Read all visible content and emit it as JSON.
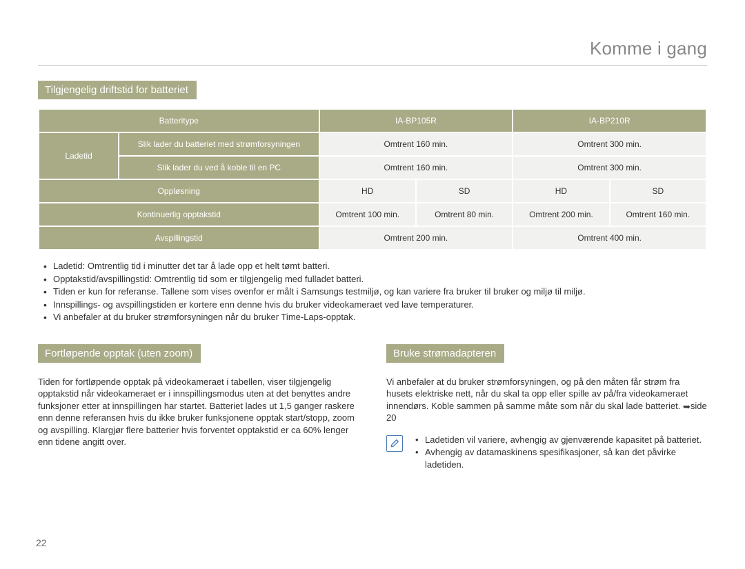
{
  "page_number": "22",
  "header_title": "Komme i gang",
  "section1": {
    "title": "Tilgjengelig driftstid for batteriet",
    "table": {
      "batteritype_label": "Batteritype",
      "col1": "IA-BP105R",
      "col2": "IA-BP210R",
      "ladetid_label": "Ladetid",
      "charge_ps_label": "Slik lader du batteriet med strømforsyningen",
      "charge_ps_c1": "Omtrent 160 min.",
      "charge_ps_c2": "Omtrent 300 min.",
      "charge_pc_label": "Slik lader du ved å koble til en PC",
      "charge_pc_c1": "Omtrent 160 min.",
      "charge_pc_c2": "Omtrent 300 min.",
      "res_label": "Oppløsning",
      "hd": "HD",
      "sd": "SD",
      "cont_label": "Kontinuerlig opptakstid",
      "cont_a": "Omtrent 100 min.",
      "cont_b": "Omtrent 80 min.",
      "cont_c": "Omtrent 200 min.",
      "cont_d": "Omtrent 160 min.",
      "play_label": "Avspillingstid",
      "play_c1": "Omtrent 200 min.",
      "play_c2": "Omtrent 400 min."
    },
    "notes": [
      "Ladetid: Omtrentlig tid i minutter det tar å lade opp et helt tømt batteri.",
      "Opptakstid/avspillingstid: Omtrentlig tid som er tilgjengelig med fulladet batteri.",
      "Tiden er kun for referanse. Tallene som vises ovenfor er målt i Samsungs testmiljø, og kan variere fra bruker til bruker og miljø til miljø.",
      "Innspillings- og avspillingstiden er kortere enn denne hvis du bruker videokameraet ved lave temperaturer.",
      "Vi anbefaler at du bruker strømforsyningen når du bruker Time-Laps-opptak."
    ]
  },
  "section2": {
    "title": "Fortløpende opptak (uten zoom)",
    "body": "Tiden for fortløpende opptak på videokameraet i tabellen, viser tilgjengelig opptakstid når videokameraet er i innspillingsmodus uten at det benyttes andre funksjoner etter at innspillingen har startet. Batteriet lades ut 1,5 ganger raskere enn denne referansen hvis du ikke bruker funksjonene opptak start/stopp, zoom og avspilling. Klargjør flere batterier hvis forventet opptakstid er ca 60% lenger enn tidene angitt over."
  },
  "section3": {
    "title": "Bruke strømadapteren",
    "body_pre": "Vi anbefaler at du bruker strømforsyningen, og på den måten får strøm fra husets elektriske nett, når du skal ta opp eller spille av på/fra videokameraet innendørs. Koble sammen på samme måte som når du skal lade batteriet. ",
    "body_ref": "side 20",
    "info": [
      "Ladetiden vil variere, avhengig av gjenværende kapasitet på batteriet.",
      "Avhengig av datamaskinens spesifikasjoner, så kan det påvirke ladetiden."
    ]
  }
}
